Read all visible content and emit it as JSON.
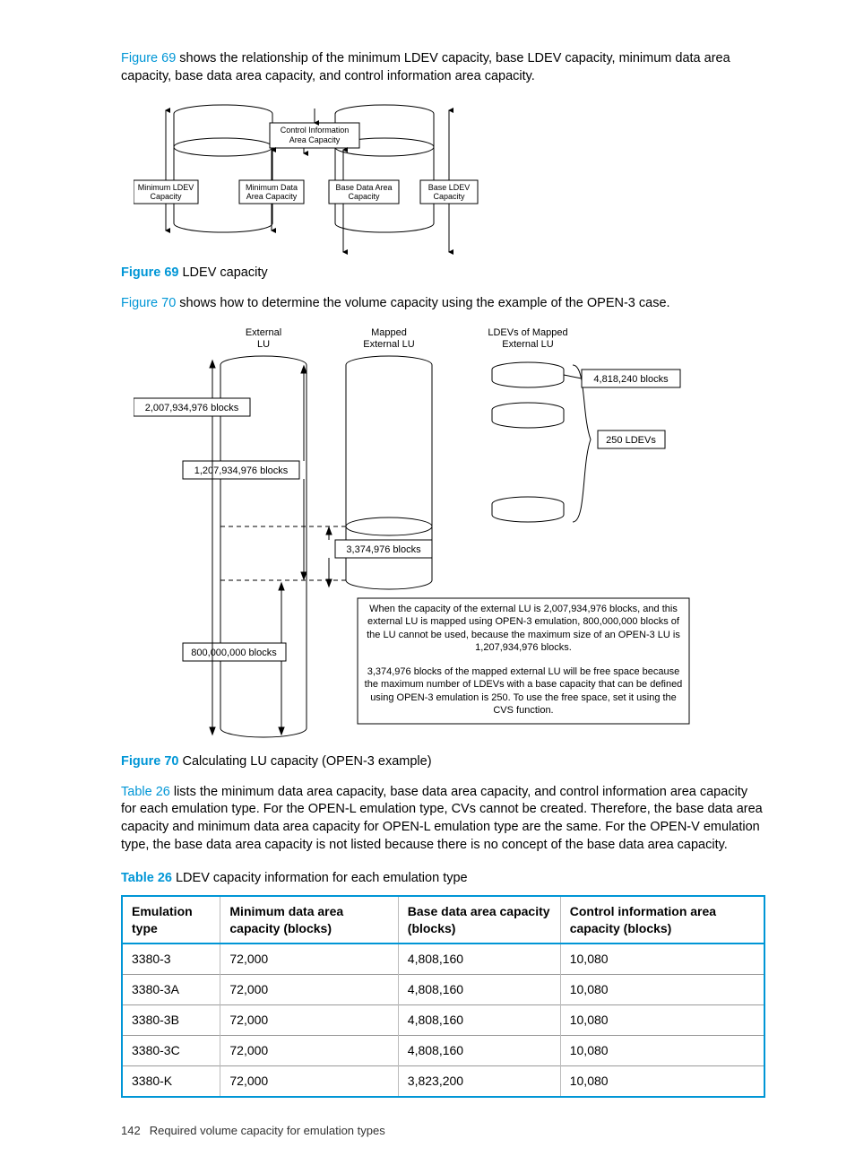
{
  "intro1_link": "Figure 69",
  "intro1_rest": " shows the relationship of the minimum LDEV capacity, base LDEV capacity, minimum data area capacity, base data area capacity, and control information area capacity.",
  "fig69": {
    "labels": {
      "ctl": "Control Information\nArea Capacity",
      "minLdev": "Minimum LDEV\nCapacity",
      "minData": "Minimum Data\nArea Capacity",
      "baseData": "Base Data Area\nCapacity",
      "baseLdev": "Base LDEV\nCapacity"
    }
  },
  "caption69_label": "Figure 69",
  "caption69_text": "  LDEV capacity",
  "intro2_link": "Figure 70",
  "intro2_rest": " shows how to determine the volume capacity using the example of the OPEN-3 case.",
  "fig70": {
    "headers": {
      "ext": "External\nLU",
      "mapped": "Mapped\nExternal LU",
      "ldevs": "LDEVs of Mapped\nExternal LU"
    },
    "nums": {
      "a": "2,007,934,976 blocks",
      "b": "1,207,934,976 blocks",
      "c": "3,374,976 blocks",
      "d": "800,000,000 blocks",
      "e": "4,818,240 blocks",
      "f": "250 LDEVs"
    },
    "box1": "When the capacity of the external LU is 2,007,934,976 blocks, and this external LU is mapped using OPEN-3 emulation, 800,000,000 blocks of the LU cannot be used, because the maximum size of an OPEN-3 LU is 1,207,934,976 blocks.",
    "box2": "3,374,976 blocks of the mapped external LU will be free space because the maximum number of LDEVs with a base capacity that can be defined using OPEN-3 emulation is 250. To use the free space, set it using the CVS function."
  },
  "caption70_label": "Figure 70",
  "caption70_text": "  Calculating LU capacity (OPEN-3 example)",
  "intro3_link": "Table 26",
  "intro3_rest": " lists the minimum data area capacity, base data area capacity, and control information area capacity for each emulation type. For the OPEN-L emulation type, CVs cannot be created. Therefore, the base data area capacity and minimum data area capacity for OPEN-L emulation type are the same. For the OPEN-V emulation type, the base data area capacity is not listed because there is no concept of the base data area capacity.",
  "table_caption_label": "Table 26",
  "table_caption_text": "   LDEV capacity information for each emulation type",
  "table": {
    "headers": [
      "Emulation type",
      "Minimum data area capacity (blocks)",
      "Base data area capacity (blocks)",
      "Control information area capacity (blocks)"
    ],
    "rows": [
      [
        "3380-3",
        "72,000",
        "4,808,160",
        "10,080"
      ],
      [
        "3380-3A",
        "72,000",
        "4,808,160",
        "10,080"
      ],
      [
        "3380-3B",
        "72,000",
        "4,808,160",
        "10,080"
      ],
      [
        "3380-3C",
        "72,000",
        "4,808,160",
        "10,080"
      ],
      [
        "3380-K",
        "72,000",
        "3,823,200",
        "10,080"
      ]
    ]
  },
  "footer_page": "142",
  "footer_text": "Required volume capacity for emulation types"
}
